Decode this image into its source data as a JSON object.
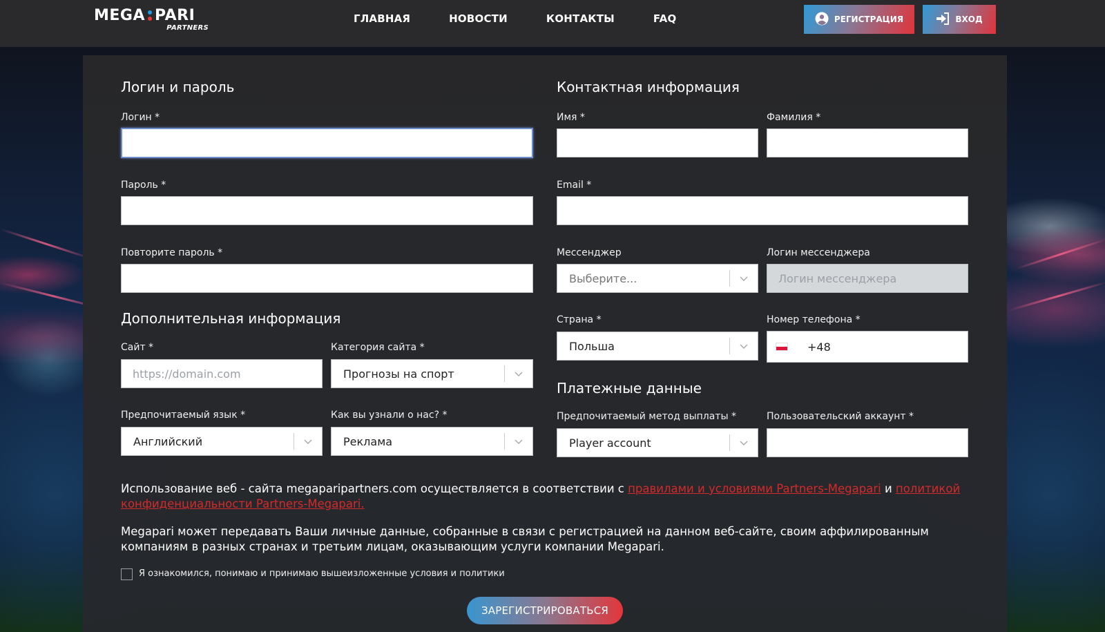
{
  "header": {
    "logo": {
      "main_left": "MEGA",
      "main_right": "PARI",
      "sub": "PARTNERS",
      "dot_top_color": "#1e9be2",
      "dot_bottom_color": "#e53935"
    },
    "nav": [
      "ГЛАВНАЯ",
      "НОВОСТИ",
      "КОНТАКТЫ",
      "FAQ"
    ],
    "register_button": "РЕГИСТРАЦИЯ",
    "login_button": "ВХОД"
  },
  "login_section": {
    "title": "Логин и пароль",
    "login_label": "Логин *",
    "login_value": "",
    "password_label": "Пароль *",
    "password_value": "",
    "repeat_password_label": "Повторите пароль *",
    "repeat_password_value": ""
  },
  "additional_section": {
    "title": "Дополнительная информация",
    "site_label": "Сайт *",
    "site_placeholder": "https://domain.com",
    "site_category_label": "Категория сайта *",
    "site_category_value": "Прогнозы на спорт",
    "language_label": "Предпочитаемый язык *",
    "language_value": "Английский",
    "source_label": "Как вы узнали о нас? *",
    "source_value": "Реклама"
  },
  "contact_section": {
    "title": "Контактная информация",
    "first_name_label": "Имя *",
    "first_name_value": "",
    "last_name_label": "Фамилия *",
    "last_name_value": "",
    "email_label": "Email *",
    "email_value": "",
    "messenger_label": "Мессенджер",
    "messenger_placeholder": "Выберите...",
    "messenger_login_label": "Логин мессенджера",
    "messenger_login_placeholder": "Логин мессенджера",
    "country_label": "Страна *",
    "country_value": "Польша",
    "phone_label": "Номер телефона *",
    "phone_code": "+48",
    "phone_flag_colors": [
      "#ffffff",
      "#dc143c"
    ]
  },
  "payment_section": {
    "title": "Платежные данные",
    "method_label": "Предпочитаемый метод выплаты *",
    "method_value": "Player account",
    "account_label": "Пользовательский аккаунт *",
    "account_value": ""
  },
  "legal": {
    "p1_prefix": "Использование веб - сайта megaparipartners.com осуществляется в соответствии с ",
    "p1_link1": "правилами и условиями Partners-Megapari",
    "p1_middle": " и ",
    "p1_link2": "политикой конфиденциальности Partners-Megapari.",
    "p2": "Megapari может передавать Ваши личные данные, собранные в связи с регистрацией на данном веб-сайте, своим аффилированным компаниям в разных странах и третьим лицам, оказывающим услуги компании Megapari.",
    "checkbox_label": "Я ознакомился, понимаю и принимаю вышеизложенные условия и политики",
    "checkbox_checked": false
  },
  "submit_button": "ЗАРЕГИСТРИРОВАТЬСЯ",
  "colors": {
    "accent_blue": "#2f9ad6",
    "accent_red": "#e0343a",
    "link_red": "#d52a2a"
  }
}
